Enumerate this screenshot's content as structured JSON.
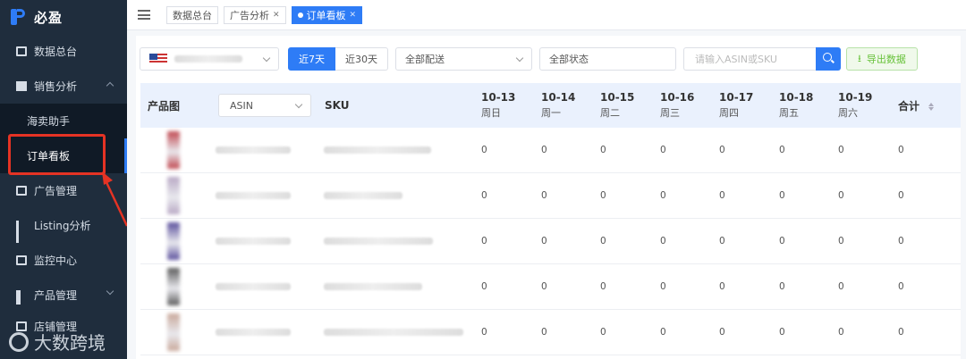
{
  "brand": {
    "name": "必盈"
  },
  "sidebar": {
    "items": [
      {
        "label": "数据总台",
        "icon": "monitor-icon"
      },
      {
        "label": "销售分析",
        "icon": "document-icon",
        "expanded": true,
        "children": [
          {
            "label": "海卖助手"
          },
          {
            "label": "订单看板",
            "active": true
          }
        ]
      },
      {
        "label": "广告管理",
        "icon": "ad-icon"
      },
      {
        "label": "Listing分析",
        "icon": "bar-chart-icon"
      },
      {
        "label": "监控中心",
        "icon": "monitor-icon"
      },
      {
        "label": "产品管理",
        "icon": "grid-icon"
      }
    ],
    "partial_item": "店铺管理"
  },
  "watermark": {
    "text": "大数跨境"
  },
  "tabs": [
    {
      "label": "数据总台",
      "closable": false
    },
    {
      "label": "广告分析",
      "closable": true
    },
    {
      "label": "订单看板",
      "closable": true,
      "active": true
    }
  ],
  "filters": {
    "marketplace": {
      "flag": "us"
    },
    "range_options": [
      "近7天",
      "近30天"
    ],
    "range_selected": "近7天",
    "delivery": "全部配送",
    "status": "全部状态",
    "search_placeholder": "请输入ASIN或SKU",
    "export_label": "导出数据"
  },
  "table": {
    "col_image": "产品图",
    "asin_select": "ASIN",
    "col_sku": "SKU",
    "col_total": "合计",
    "dates": [
      {
        "date": "10-13",
        "weekday": "周日"
      },
      {
        "date": "10-14",
        "weekday": "周一"
      },
      {
        "date": "10-15",
        "weekday": "周二"
      },
      {
        "date": "10-16",
        "weekday": "周三"
      },
      {
        "date": "10-17",
        "weekday": "周四"
      },
      {
        "date": "10-18",
        "weekday": "周五"
      },
      {
        "date": "10-19",
        "weekday": "周六"
      }
    ],
    "rows": [
      {
        "values": [
          "0",
          "0",
          "0",
          "0",
          "0",
          "0",
          "0",
          "0"
        ],
        "thumb_color": "#c0474f"
      },
      {
        "values": [
          "0",
          "0",
          "0",
          "0",
          "0",
          "0",
          "0",
          "0"
        ],
        "thumb_color": "#b8a8c4"
      },
      {
        "values": [
          "0",
          "0",
          "0",
          "0",
          "0",
          "0",
          "0",
          "0"
        ],
        "thumb_color": "#5a4f9c"
      },
      {
        "values": [
          "0",
          "0",
          "0",
          "0",
          "0",
          "0",
          "0",
          "0"
        ],
        "thumb_color": "#5b5b5b"
      },
      {
        "values": [
          "0",
          "0",
          "0",
          "0",
          "0",
          "0",
          "0",
          "0"
        ],
        "thumb_color": "#c9a89a"
      }
    ]
  },
  "colors": {
    "accent": "#2e7cf6",
    "sidebar_bg": "#1f2d3d",
    "header_bg": "#eaf1fd",
    "highlight": "#e53324"
  }
}
